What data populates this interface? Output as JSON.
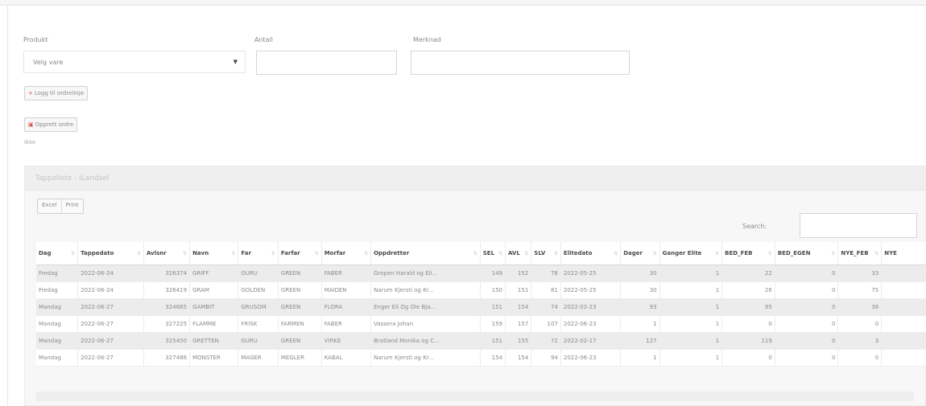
{
  "form": {
    "produkt_label": "Produkt",
    "produkt_value": "Velg vare",
    "antall_label": "Antall",
    "antall_value": "",
    "merknad_label": "Merknad",
    "merknad_value": "",
    "logg_button": "Logg til ordrelinje",
    "opprett_button": "Opprett ordre",
    "status_text": "Ikke"
  },
  "panel": {
    "title": "Tappeliste - iLandsel",
    "export_buttons": [
      "Excel",
      "Print"
    ],
    "search_label": "Search:",
    "search_value": ""
  },
  "table": {
    "columns": [
      "Dag",
      "Tappedato",
      "Avlsnr",
      "Navn",
      "Far",
      "Farfar",
      "Morfar",
      "Oppdretter",
      "SEL",
      "AVL",
      "SLV",
      "Elitedato",
      "Dager",
      "Ganger Elite",
      "BED_FEB",
      "BED_EGEN",
      "NYE_FEB",
      "NYE"
    ],
    "rows": [
      [
        "Fredag",
        "2022-06-24",
        "326374",
        "GRIFF",
        "GURU",
        "GREEN",
        "FABER",
        "Gropen Harald og Eli...",
        "149",
        "152",
        "78",
        "2022-05-25",
        "30",
        "1",
        "22",
        "0",
        "33",
        ""
      ],
      [
        "Fredag",
        "2022-06-24",
        "326419",
        "GRAM",
        "GOLDEN",
        "GREEN",
        "MAIDEN",
        "Narum Kjersti og Kr...",
        "150",
        "151",
        "81",
        "2022-05-25",
        "30",
        "1",
        "26",
        "0",
        "75",
        ""
      ],
      [
        "Mandag",
        "2022-06-27",
        "324665",
        "GAMBIT",
        "GRUSOM",
        "GREEN",
        "FLORA",
        "Enger Eli Og Ole Bja...",
        "151",
        "154",
        "74",
        "2022-03-23",
        "93",
        "1",
        "95",
        "0",
        "38",
        ""
      ],
      [
        "Mandag",
        "2022-06-27",
        "327225",
        "FLAMME",
        "FRISK",
        "FARMEN",
        "FABER",
        "Vassera Johan",
        "159",
        "157",
        "107",
        "2022-06-23",
        "1",
        "1",
        "0",
        "0",
        "0",
        ""
      ],
      [
        "Mandag",
        "2022-06-27",
        "325450",
        "GRETTEN",
        "GURU",
        "GREEN",
        "VIRKE",
        "Bratland Monika og C...",
        "151",
        "155",
        "72",
        "2022-02-17",
        "127",
        "1",
        "119",
        "0",
        "3",
        ""
      ],
      [
        "Mandag",
        "2022-06-27",
        "327486",
        "MONSTER",
        "MAGER",
        "MEGLER",
        "KABAL",
        "Narum Kjersti og Kr...",
        "154",
        "154",
        "94",
        "2022-06-23",
        "1",
        "1",
        "0",
        "0",
        "0",
        ""
      ]
    ]
  }
}
